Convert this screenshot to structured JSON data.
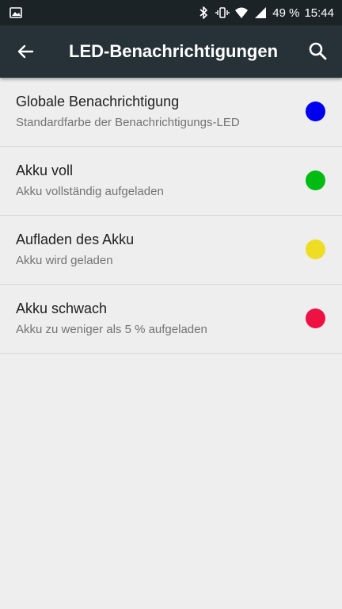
{
  "status_bar": {
    "battery_text": "49 %",
    "time": "15:44",
    "icons": [
      "image-icon",
      "bluetooth-icon",
      "vibrate-icon",
      "wifi-icon",
      "signal-icon"
    ]
  },
  "app_bar": {
    "title": "LED-Benachrichtigungen",
    "back_icon": "arrow-left-icon",
    "search_icon": "search-icon"
  },
  "colors": {
    "status_bar_bg": "#1b2327",
    "app_bar_bg": "#263238",
    "page_bg": "#eeeeee"
  },
  "items": [
    {
      "title": "Globale Benachrichtigung",
      "subtitle": "Standardfarbe der Benachrichtigungs-LED",
      "color": "#0000ee"
    },
    {
      "title": "Akku voll",
      "subtitle": "Akku vollständig aufgeladen",
      "color": "#00bb11"
    },
    {
      "title": "Aufladen des Akku",
      "subtitle": "Akku wird geladen",
      "color": "#eedd22"
    },
    {
      "title": "Akku schwach",
      "subtitle": "Akku zu weniger als 5 % aufgeladen",
      "color": "#ee1144"
    }
  ]
}
